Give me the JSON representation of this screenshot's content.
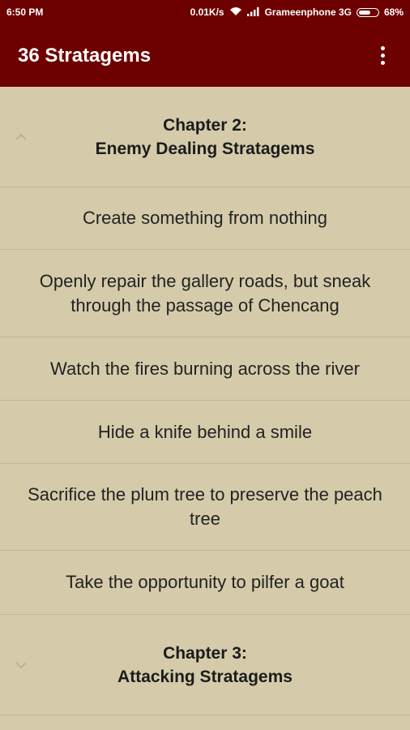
{
  "status": {
    "time": "6:50 PM",
    "speed": "0.01K/s",
    "carrier": "Grameenphone 3G",
    "battery": "68%",
    "battery_level": 0.68
  },
  "appbar": {
    "title": "36 Stratagems",
    "menu_icon": "more-vert-icon"
  },
  "sections": [
    {
      "line1": "Chapter 2:",
      "line2": "Enemy Dealing Stratagems",
      "expanded": true,
      "items": [
        "Create something from nothing",
        "Openly repair the gallery roads, but sneak through the passage of Chencang",
        "Watch the fires burning across the river",
        "Hide a knife behind a smile",
        "Sacrifice the plum tree to preserve the peach tree",
        "Take the opportunity to pilfer a goat"
      ]
    },
    {
      "line1": "Chapter 3:",
      "line2": "Attacking Stratagems",
      "expanded": false
    }
  ],
  "colors": {
    "primary": "#6d0000",
    "background": "#d5cbaa",
    "divider": "#c3b894"
  }
}
